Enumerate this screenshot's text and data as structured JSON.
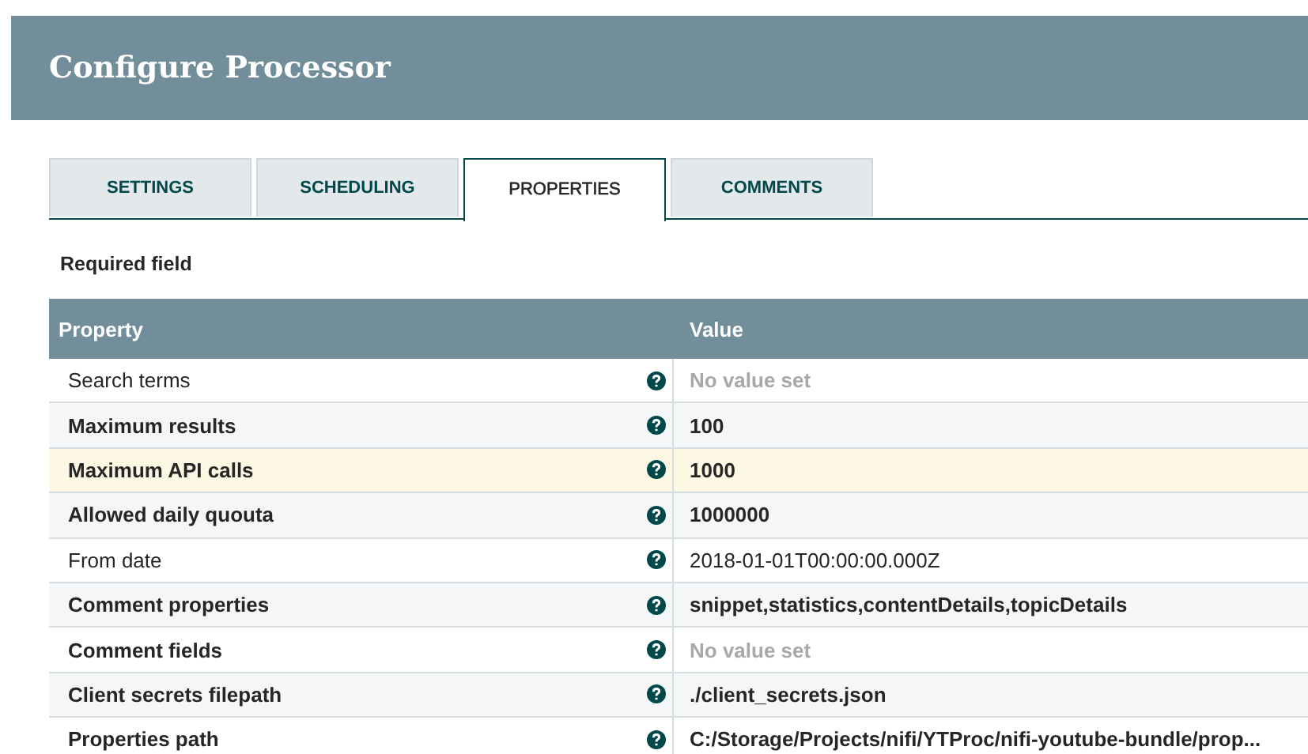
{
  "window": {
    "title": "Configure Processor"
  },
  "tabs": [
    {
      "label": "SETTINGS",
      "selected": false
    },
    {
      "label": "SCHEDULING",
      "selected": false
    },
    {
      "label": "PROPERTIES",
      "selected": true
    },
    {
      "label": "COMMENTS",
      "selected": false
    }
  ],
  "legend": "Required field",
  "table": {
    "columns": [
      "Property",
      "Value"
    ],
    "rows": [
      {
        "name": "Search terms",
        "required": false,
        "value": "No value set",
        "unset": true,
        "selected": false
      },
      {
        "name": "Maximum results",
        "required": true,
        "value": "100",
        "unset": false,
        "selected": false
      },
      {
        "name": "Maximum API calls",
        "required": true,
        "value": "1000",
        "unset": false,
        "selected": true
      },
      {
        "name": "Allowed daily quouta",
        "required": true,
        "value": "1000000",
        "unset": false,
        "selected": false
      },
      {
        "name": "From date",
        "required": false,
        "value": "2018-01-01T00:00:00.000Z",
        "unset": false,
        "selected": false
      },
      {
        "name": "Comment properties",
        "required": true,
        "value": "snippet,statistics,contentDetails,topicDetails",
        "unset": false,
        "selected": false
      },
      {
        "name": "Comment fields",
        "required": true,
        "value": "No value set",
        "unset": true,
        "selected": false
      },
      {
        "name": "Client secrets filepath",
        "required": true,
        "value": "./client_secrets.json",
        "unset": false,
        "selected": false
      },
      {
        "name": "Properties path",
        "required": true,
        "value": "C:/Storage/Projects/nifi/YTProc/nifi-youtube-bundle/prop...",
        "unset": false,
        "selected": false
      }
    ]
  }
}
